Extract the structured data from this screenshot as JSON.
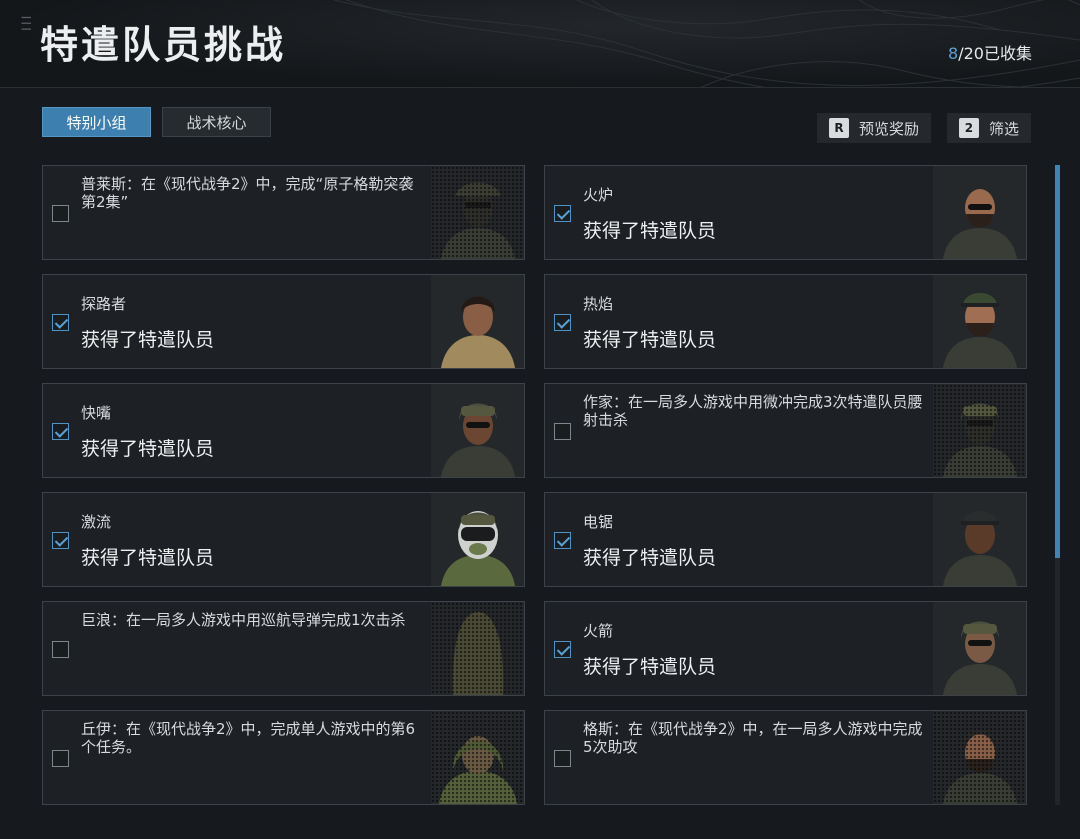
{
  "header": {
    "title": "特遣队员挑战",
    "collected_count": "8",
    "collected_total": "/20已收集"
  },
  "tabs": [
    {
      "label": "特别小组",
      "active": true
    },
    {
      "label": "战术核心",
      "active": false
    }
  ],
  "actions": [
    {
      "key": "R",
      "label": "预览奖励"
    },
    {
      "key": "2",
      "label": "筛选"
    }
  ],
  "cards": [
    {
      "checked": false,
      "locked": true,
      "text": "普莱斯：在《现代战争2》中，完成“原子格勒突袭第2集”",
      "portrait": "operator-boonie-hat"
    },
    {
      "checked": true,
      "locked": false,
      "name": "火炉",
      "status": "获得了特遣队员",
      "portrait": "operator-bearded-sunglasses"
    },
    {
      "checked": true,
      "locked": false,
      "name": "探路者",
      "status": "获得了特遣队员",
      "portrait": "operator-female-scarf"
    },
    {
      "checked": true,
      "locked": false,
      "name": "热焰",
      "status": "获得了特遣队员",
      "portrait": "operator-bearded-cap"
    },
    {
      "checked": true,
      "locked": false,
      "name": "快嘴",
      "status": "获得了特遣队员",
      "portrait": "operator-helmet-sunglasses"
    },
    {
      "checked": false,
      "locked": true,
      "text": "作家：在一局多人游戏中用微冲完成3次特遣队员腰射击杀",
      "portrait": "operator-masked-helmet"
    },
    {
      "checked": true,
      "locked": false,
      "name": "激流",
      "status": "获得了特遣队员",
      "portrait": "operator-pilot-helmet"
    },
    {
      "checked": true,
      "locked": false,
      "name": "电锯",
      "status": "获得了特遣队员",
      "portrait": "operator-female-cap"
    },
    {
      "checked": false,
      "locked": true,
      "text": "巨浪：在一局多人游戏中用巡航导弹完成1次击杀",
      "portrait": "operator-ghillie"
    },
    {
      "checked": true,
      "locked": false,
      "name": "火箭",
      "status": "获得了特遣队员",
      "portrait": "operator-helmet-mask"
    },
    {
      "checked": false,
      "locked": true,
      "text": "丘伊：在《现代战争2》中，完成单人游戏中的第6个任务。",
      "portrait": "operator-camo-hood"
    },
    {
      "checked": false,
      "locked": true,
      "text": "格斯：在《现代战争2》中，在一局多人游戏中完成5次助攻",
      "portrait": "operator-headset-beard"
    }
  ],
  "colors": {
    "accent": "#3d7fae",
    "check": "#5aa2d4",
    "background": "#16191d"
  }
}
